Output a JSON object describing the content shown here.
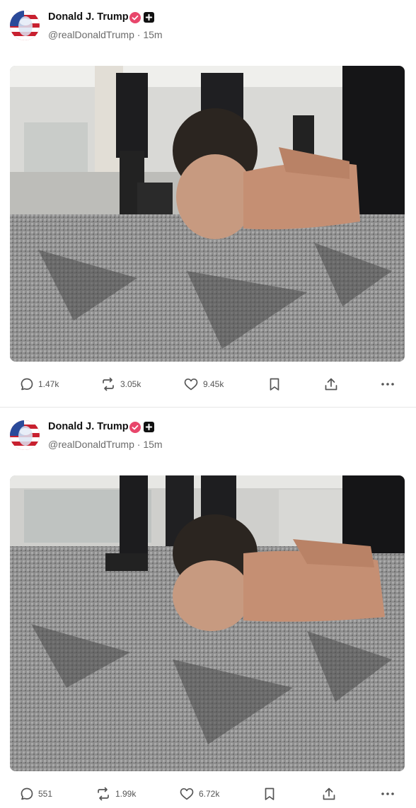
{
  "posts": [
    {
      "author": {
        "name": "Donald J. Trump",
        "handle": "@realDonaldTrump",
        "time": "15m"
      },
      "separator": "·",
      "stats": {
        "replies": "1.47k",
        "reposts": "3.05k",
        "likes": "9.45k"
      },
      "icons": [
        "reply-icon",
        "repost-icon",
        "like-icon",
        "bookmark-icon",
        "share-icon",
        "more-icon"
      ]
    },
    {
      "author": {
        "name": "Donald J. Trump",
        "handle": "@realDonaldTrump",
        "time": "15m"
      },
      "separator": "·",
      "stats": {
        "replies": "551",
        "reposts": "1.99k",
        "likes": "6.72k"
      },
      "icons": [
        "reply-icon",
        "repost-icon",
        "like-icon",
        "bookmark-icon",
        "share-icon",
        "more-icon"
      ]
    }
  ],
  "colors": {
    "verified": "#e8466b",
    "text_secondary": "#6b6b6b",
    "divider": "#e6e6e6"
  }
}
